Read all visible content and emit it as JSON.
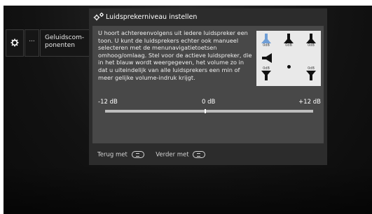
{
  "menu": {
    "gear_icon": "gear-icon",
    "more_label": "...",
    "item_label": "Geluidscom-\nponenten"
  },
  "dialog": {
    "title_icon": "gear-icon",
    "title": "Luidsprekerniveau instellen",
    "body_text": "U hoort achtereenvolgens uit iedere luidspreker een toon. U kunt de luidsprekers echter ook manueel selecteren met de menunavigatietoetsen omhoog/omlaag. Stel voor de actieve luidspreker, die in het blauw wordt weergegeven, het volume zo in dat u uiteindelijk van alle luidsprekers een min of meer gelijke volume-indruk krijgt.",
    "speakers": {
      "front_left": "0dB",
      "center": "0dB",
      "front_right": "0dB",
      "side_left": "0dB",
      "side_right": "0dB",
      "active_color": "#6f9ed6"
    },
    "slider": {
      "min_label": "-12 dB",
      "mid_label": "0 dB",
      "max_label": "+12 dB",
      "value_db": 0
    },
    "footer": {
      "back_label": "Terug met",
      "next_label": "Verder met"
    }
  }
}
